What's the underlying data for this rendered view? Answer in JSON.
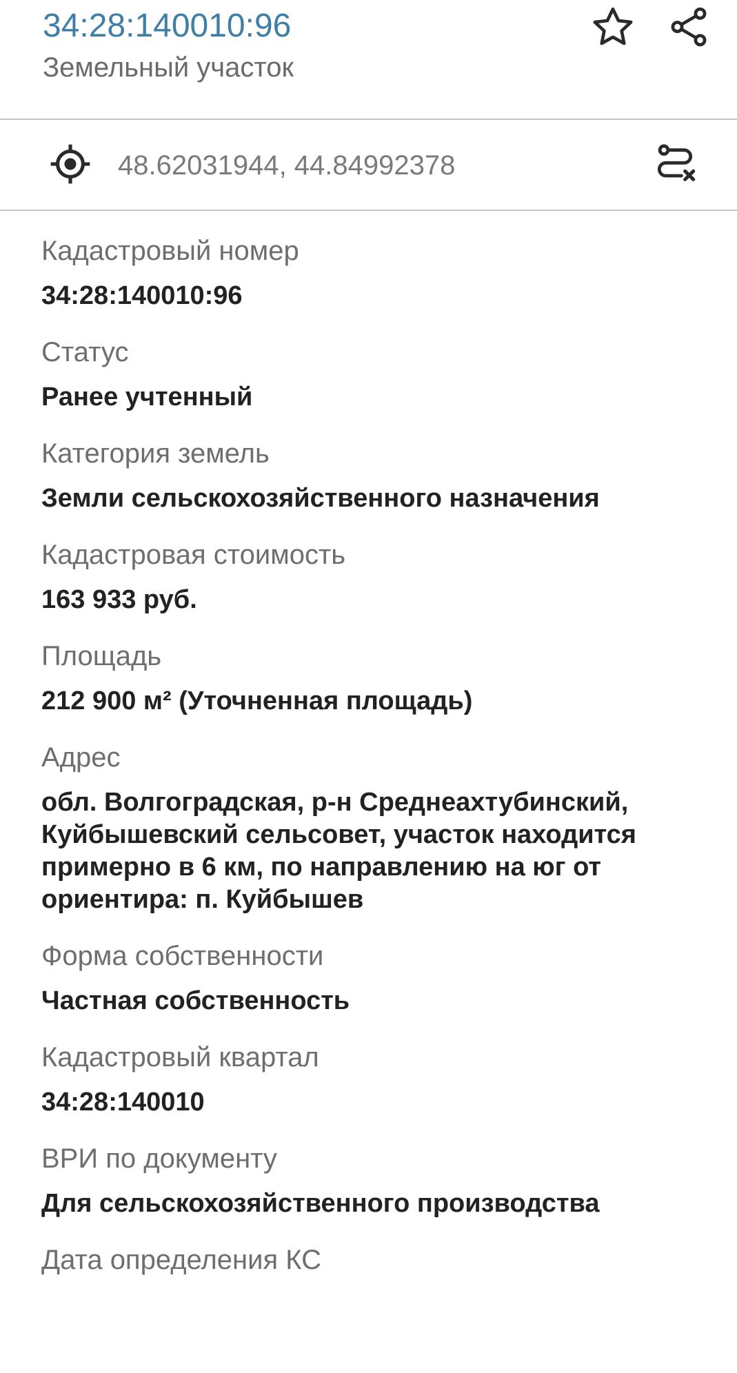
{
  "header": {
    "title": "34:28:140010:96",
    "subtitle": "Земельный участок",
    "icons": {
      "favorite": "star-icon",
      "share": "share-icon"
    }
  },
  "coords": {
    "value": "48.62031944, 44.84992378",
    "icons": {
      "locate": "crosshair-icon",
      "route": "route-icon"
    }
  },
  "fields": [
    {
      "label": "Кадастровый номер",
      "value": "34:28:140010:96"
    },
    {
      "label": "Статус",
      "value": "Ранее учтенный"
    },
    {
      "label": "Категория земель",
      "value": "Земли сельскохозяйственного назначения"
    },
    {
      "label": "Кадастровая стоимость",
      "value": "163 933 руб."
    },
    {
      "label": "Площадь",
      "value": "212 900 м² (Уточненная площадь)"
    },
    {
      "label": "Адрес",
      "value": "обл. Волгоградская, р-н Среднеахтубинский, Куйбышевский сельсовет, участок находится примерно в 6 км, по направлению на юг от ориентира: п. Куйбышев"
    },
    {
      "label": "Форма собственности",
      "value": "Частная собственность"
    },
    {
      "label": "Кадастровый квартал",
      "value": "34:28:140010"
    },
    {
      "label": "ВРИ по документу",
      "value": "Для сельскохозяйственного производства"
    },
    {
      "label": "Дата определения КС",
      "value": ""
    }
  ],
  "colors": {
    "title": "#3f7ea6",
    "label": "#6e6e6e",
    "value": "#222222",
    "divider": "#c8c8c8"
  }
}
